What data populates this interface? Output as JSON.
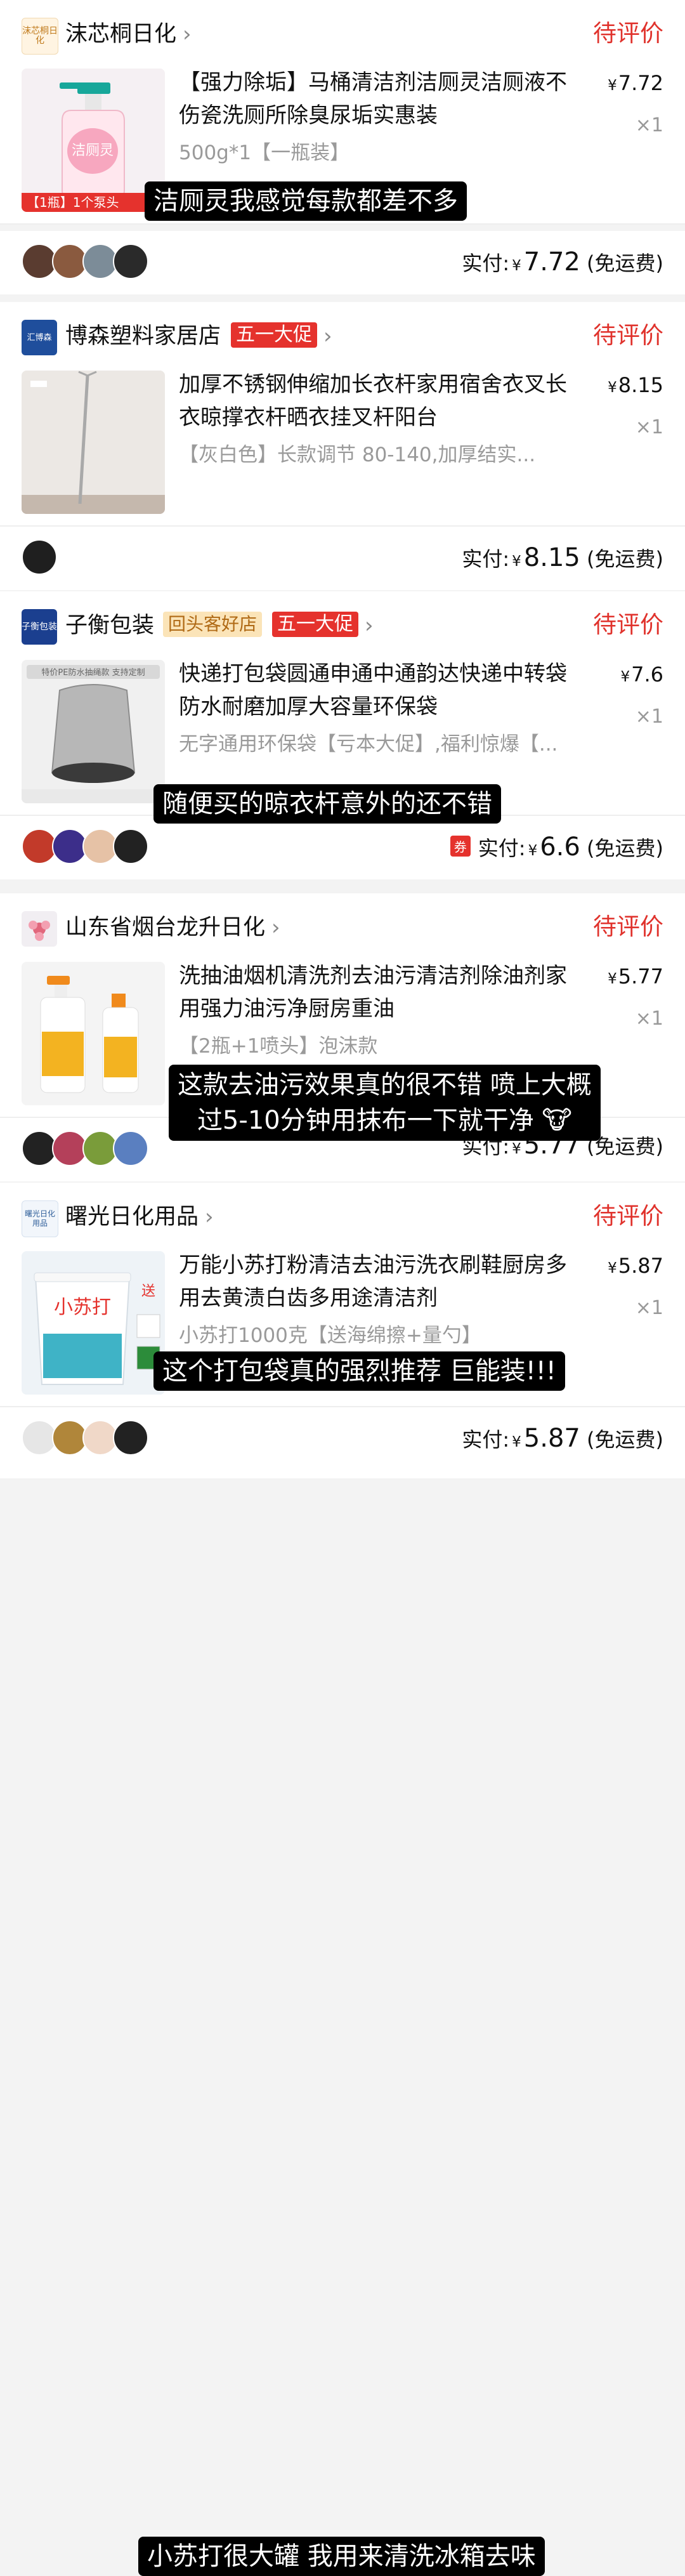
{
  "orders": [
    {
      "shop": {
        "logo_text": "沫芯桐日化",
        "name": "沫芯桐日化",
        "promo": "",
        "return_badge": ""
      },
      "status": "待评价",
      "title": "【强力除垢】马桶清洁剂洁厕灵洁厕液不伤瓷洗厕所除臭尿垢实惠装",
      "variant": "500g*1【一瓶装】",
      "price_symbol": "¥",
      "price": "7.72",
      "qty": "×1",
      "caption": "洁厕灵我感觉每款都差不多",
      "thumb_label": "【1瓶】1个泵头",
      "paid_label": "实付:",
      "paid_amount": "7.72",
      "shipping": "(免运费)",
      "coupon": ""
    },
    {
      "shop": {
        "logo_text": "汇博森",
        "name": "博森塑料家居店",
        "promo": "五一大促",
        "return_badge": ""
      },
      "status": "待评价",
      "title": "加厚不锈钢伸缩加长衣杆家用宿舍衣叉长衣晾撑衣杆晒衣挂叉杆阳台",
      "variant": "【灰白色】长款调节 80-140,加厚结实...",
      "price_symbol": "¥",
      "price": "8.15",
      "qty": "×1",
      "caption": "随便买的晾衣杆意外的还不错",
      "thumb_label": "",
      "paid_label": "实付:",
      "paid_amount": "8.15",
      "shipping": "(免运费)",
      "coupon": ""
    },
    {
      "shop": {
        "logo_text": "子衡包装",
        "name": "子衡包装",
        "promo": "五一大促",
        "return_badge": "回头客好店"
      },
      "status": "待评价",
      "title": "快递打包袋圆通申通中通韵达快递中转袋防水耐磨加厚大容量环保袋",
      "variant": "无字通用环保袋【亏本大促】,福利惊爆【...",
      "price_symbol": "¥",
      "price": "7.6",
      "qty": "×1",
      "caption": "这个打包袋真的强烈推荐 巨能装!!!",
      "thumb_label": "特价PE防水抽绳款 支持定制",
      "paid_label": "实付:",
      "paid_amount": "6.6",
      "shipping": "(免运费)",
      "coupon": "券"
    },
    {
      "shop": {
        "logo_text": "",
        "name": "山东省烟台龙升日化",
        "promo": "",
        "return_badge": ""
      },
      "status": "待评价",
      "title": "洗抽油烟机清洗剂去油污清洁剂除油剂家用强力油污净厨房重油",
      "variant": "【2瓶+1喷头】泡沫款",
      "price_symbol": "¥",
      "price": "5.77",
      "qty": "×1",
      "caption_lines": [
        "这款去油污效果真的很不错 喷上大概",
        "过5-10分钟用抹布一下就干净 🐮"
      ],
      "thumb_label": "",
      "paid_label": "实付:",
      "paid_amount": "5.77",
      "shipping": "(免运费)",
      "coupon": ""
    },
    {
      "shop": {
        "logo_text": "曙光日化用品",
        "name": "曙光日化用品",
        "promo": "",
        "return_badge": ""
      },
      "status": "待评价",
      "title": "万能小苏打粉清洁去油污洗衣刷鞋厨房多用去黄渍白齿多用途清洁剂",
      "variant": "小苏打1000克【送海绵擦+量勺】",
      "price_symbol": "¥",
      "price": "5.87",
      "qty": "×1",
      "caption": "小苏打很大罐 我用来清洗冰箱去味",
      "thumb_label": "小苏打",
      "thumb_badge": "送",
      "paid_label": "实付:",
      "paid_amount": "5.87",
      "shipping": "(免运费)",
      "coupon": ""
    }
  ],
  "colors": {
    "status_red": "#e0322c",
    "promo_red": "#e5322d"
  }
}
